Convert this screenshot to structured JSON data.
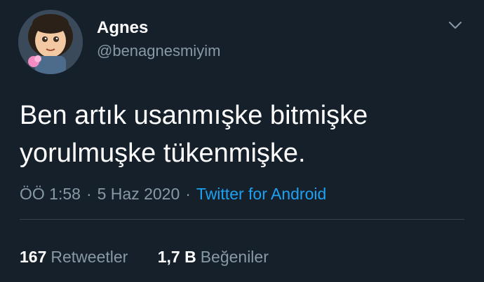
{
  "tweet": {
    "user": {
      "name": "Agnes",
      "handle": "@benagnesmiyim",
      "avatar_icon": "cartoon-girl-avatar"
    },
    "text": "Ben artık usanmışke bitmişke\nyorulmuşke tükenmişke.",
    "meta": {
      "time": "ÖÖ 1:58",
      "separator": "·",
      "date": "5 Haz 2020",
      "source": "Twitter for Android"
    },
    "stats": {
      "retweets_count": "167",
      "retweets_label": "Retweetler",
      "likes_count": "1,7 B",
      "likes_label": "Beğeniler"
    },
    "menu_icon": "chevron-down-icon"
  },
  "colors": {
    "background": "#15202b",
    "primary_text": "#ffffff",
    "secondary_text": "#8899a6",
    "link": "#1da1f2",
    "divider": "#38444d"
  }
}
